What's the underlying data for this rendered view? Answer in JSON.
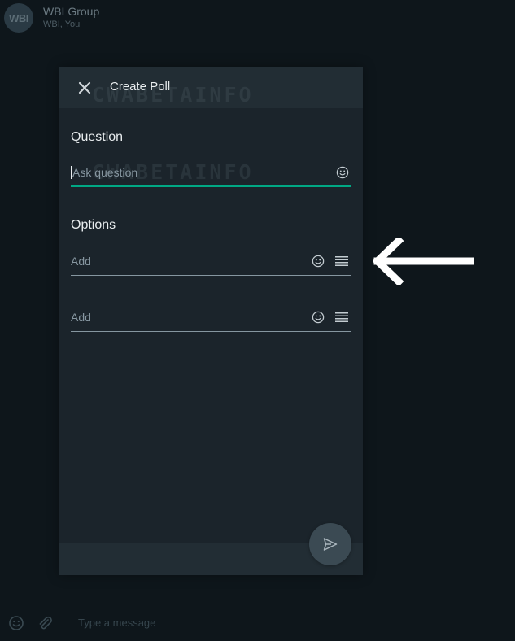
{
  "chat": {
    "avatar_text": "WBI",
    "title": "WBI Group",
    "subtitle": "WBI, You",
    "composer_placeholder": "Type a message"
  },
  "modal": {
    "title": "Create Poll",
    "watermark": "CWABETAINFO",
    "question": {
      "label": "Question",
      "placeholder": "Ask question",
      "value": ""
    },
    "options": {
      "label": "Options",
      "items": [
        {
          "placeholder": "Add",
          "value": ""
        },
        {
          "placeholder": "Add",
          "value": ""
        }
      ]
    }
  },
  "icons": {
    "close": "close-icon",
    "emoji": "emoji-icon",
    "drag": "drag-handle-icon",
    "send": "send-icon",
    "attach": "paperclip-icon",
    "annotation": "arrow-left-icon"
  },
  "colors": {
    "accent": "#00a884",
    "modal_bg": "#1b242b",
    "header_bg": "#222d34",
    "page_bg": "#0e161b"
  }
}
